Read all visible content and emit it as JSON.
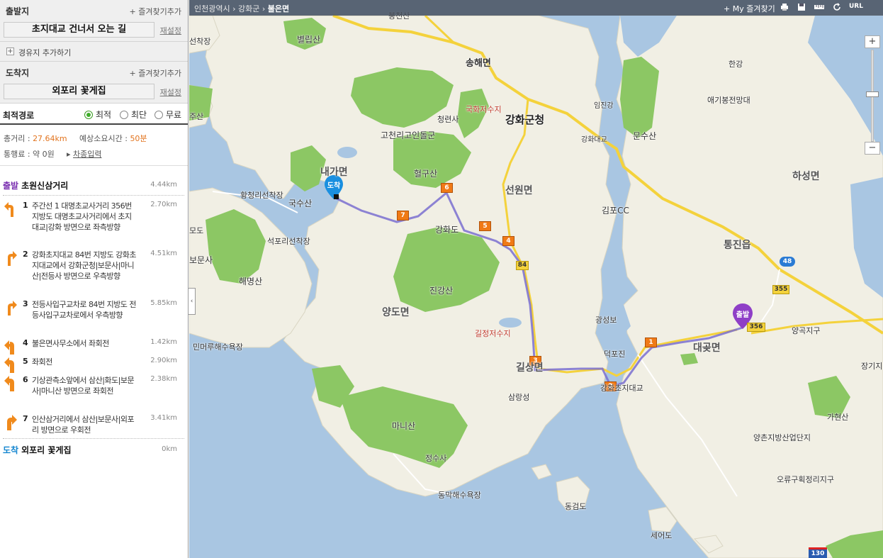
{
  "panel": {
    "start": {
      "title": "출발지",
      "fav": "즐겨찾기추가",
      "value": "초지대교 건너서 오는 길",
      "reset": "재설정"
    },
    "waypoint": {
      "label": "경유지 추가하기"
    },
    "end": {
      "title": "도착지",
      "fav": "즐겨찾기추가",
      "value": "외포리 꽃게집",
      "reset": "재설정"
    },
    "options": {
      "title": "최적경로",
      "choices": [
        "최적",
        "최단",
        "무료"
      ],
      "selected": "최적"
    },
    "summary": {
      "distance_label": "총거리 :",
      "distance": "27.64km",
      "time_label": "예상소요시간 :",
      "time": "50분",
      "toll_label": "통행료 : 약 0원",
      "car_link": "차종입력"
    },
    "route": {
      "start_tag": "출발",
      "start_name": "초원신삼거리",
      "start_km": "4.44km",
      "steps": [
        {
          "no": "1",
          "text": "주간선 1 대명초교사거리 356번 지방도 대명초교사거리에서 초지대교|강화 방면으로 좌측방향",
          "km": "2.70km",
          "icon": "keep-left-icon"
        },
        {
          "no": "2",
          "text": "강화초지대교 84번 지방도 강화초지대교에서 강화군청|보문사|마니산|전등사 방면으로 우측방향",
          "km": "4.51km",
          "icon": "keep-right-icon"
        },
        {
          "no": "3",
          "text": "전등사입구교차로 84번 지방도 전등사입구교차로에서 우측방향",
          "km": "5.85km",
          "icon": "keep-right-icon"
        },
        {
          "no": "4",
          "text": "불은면사무소에서 좌회전",
          "km": "1.42km",
          "icon": "turn-left-icon"
        },
        {
          "no": "5",
          "text": "좌회전",
          "km": "2.90km",
          "icon": "turn-left-icon"
        },
        {
          "no": "6",
          "text": "기상관측소앞에서 삼산|화도|보문사|마니산 방면으로 좌회전",
          "km": "2.38km",
          "icon": "turn-left-icon"
        },
        {
          "no": "7",
          "text": "인산삼거리에서 삼산|보문사|외포리 방면으로 우회전",
          "km": "3.41km",
          "icon": "turn-right-icon"
        }
      ],
      "end_tag": "도착",
      "end_name": "외포리 꽃게집",
      "end_km": "0km"
    }
  },
  "topbar": {
    "crumbs": [
      "인천광역시",
      "강화군"
    ],
    "current": "불은면",
    "myfav": "My 즐겨찾기",
    "icons": [
      "print-icon",
      "save-icon",
      "ruler-icon",
      "refresh-icon",
      "url-icon"
    ],
    "url_label": "URL"
  },
  "map": {
    "labels": {
      "bongcheonsan": "봉천산",
      "byeolripsan": "별립산",
      "seonchuljang": "선착장",
      "songhae": "송해면",
      "daesan": "대산산",
      "gukhwa": "국화저수지",
      "ganghwagun": "강화군청",
      "cheongryeonsa": "청련사",
      "goindol": "고천리고인돌군",
      "hyeolgusan": "혈구산",
      "naega": "내가면",
      "ganghwado": "강화도",
      "seonwon": "선원면",
      "gimpocc": "김포CC",
      "gangwhadaegyo": "강화대교",
      "munsusan": "문수산",
      "ipjingang": "임진강",
      "hangang": "한강",
      "aegibong": "애기봉전망대",
      "haseong": "하성면",
      "tongjin": "통진읍",
      "hwangcheong": "황청리선착장",
      "guksusan": "국수산",
      "seokpo": "석포리선착장",
      "modo": "모도",
      "bomunsa": "보문사",
      "haemyeong": "해명산",
      "jingangsan": "진강산",
      "yangdo": "양도면",
      "gilsang": "길상면",
      "gilsangjeo": "길정저수지",
      "gwangseongbo": "광성보",
      "deokpojin": "덕포진",
      "daegot": "대곶면",
      "yanggok": "양곡지구",
      "janggi": "장기지",
      "gahyeon": "가현산",
      "yangchon": "양촌지방산업단지",
      "oryu": "오류구획정리지구",
      "minmeoru": "민머루해수욕장",
      "samrang": "삼랑성",
      "manisan": "마니산",
      "jeongsusa": "정수사",
      "dongmak": "동막해수욕장",
      "donggeom": "동검도",
      "seeodo": "세어도",
      "choji": "강화초지대교",
      "bulleun": "불은면",
      "jusan": "주산",
      "jeokseok": "적석사"
    },
    "markers": {
      "start": "출발",
      "end": "도착"
    },
    "road_numbers": {
      "r48": "48",
      "r84": "84",
      "r355": "355",
      "r356": "356",
      "r130": "130"
    },
    "step_flags": [
      "1",
      "2",
      "3",
      "4",
      "5",
      "6",
      "7"
    ]
  },
  "colors": {
    "route": "#7a6fd0",
    "start_marker": "#8f3fc7",
    "end_marker": "#1a8fe0",
    "flag": "#f07a16",
    "green": "#7fc35a",
    "land": "#f1efe4",
    "sea": "#a9c6e2"
  }
}
